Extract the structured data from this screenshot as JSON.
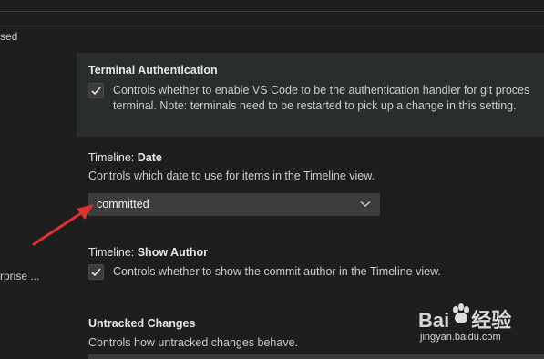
{
  "left_fragments": {
    "top": "sed",
    "middle": "rprise ..."
  },
  "settings": [
    {
      "title": "Terminal Authentication",
      "category": "",
      "checked": true,
      "line1": "Controls whether to enable VS Code to be the authentication handler for git proces",
      "line2": "terminal. Note: terminals need to be restarted to pick up a change in this setting."
    },
    {
      "category": "Timeline: ",
      "title": "Date",
      "description": "Controls which date to use for items in the Timeline view.",
      "selected": "committed"
    },
    {
      "category": "Timeline: ",
      "title": "Show Author",
      "checked": true,
      "description": "Controls whether to show the commit author in the Timeline view."
    },
    {
      "title": "Untracked Changes",
      "description": "Controls how untracked changes behave."
    }
  ],
  "watermark": {
    "logo_left": "Bai",
    "logo_right": "经验",
    "url": "jingyan.baidu.com"
  },
  "colors": {
    "background": "#1e1e1e",
    "highlight": "#2a2d2e",
    "annotation_arrow": "#e03030"
  },
  "icons": [
    "check-icon",
    "chevron-down-icon",
    "red-arrow-annotation",
    "baidu-paw-icon"
  ]
}
